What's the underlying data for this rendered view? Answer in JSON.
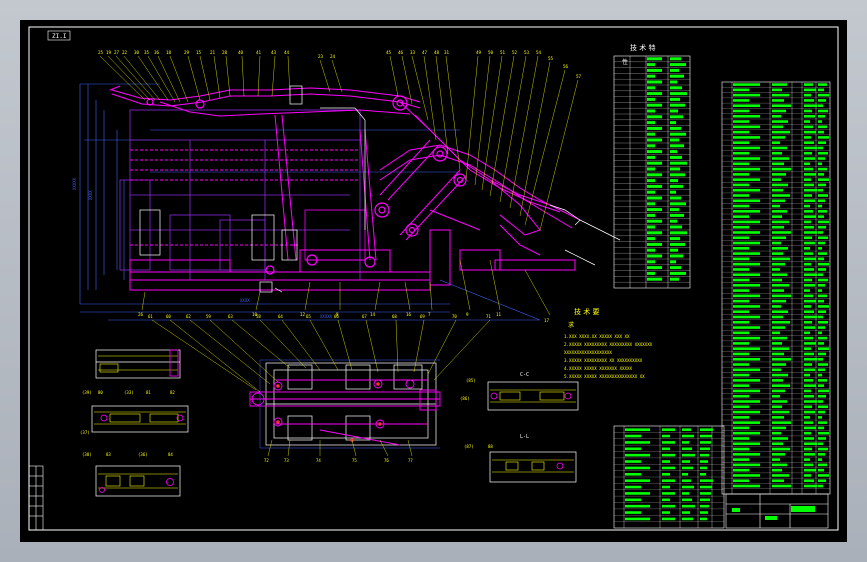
{
  "sheet": {
    "zone_label": "ZI.I",
    "tech_table_title": "技 术 特",
    "tech_table_sub": "性",
    "requirements": {
      "title": "技 术 要",
      "title2": "求",
      "lines": [
        "1.XXX XXXX.XX XXXXX XXX XX",
        "2.XXXXX XXXXXXXXX XXXXXXXXX XXXXXXX",
        "XXXXXXXXXXXXXXXXXXX",
        "3.XXXXX XXXXXXXXX XX XXXXXXXXXX",
        "4.XXXXX XXXXX XXXXXXX XXXXX",
        "5.XXXXX XXXXX XXXXXXXXXXXXXXX XX"
      ]
    },
    "section_labels": {
      "top": "C-C",
      "bottom": "L-L"
    }
  },
  "colors": {
    "background": "#000000",
    "frame": "#ffffff",
    "assembly": "#ff00ff",
    "hidden": "#8a2be2",
    "dimension": "#3f63ff",
    "outline": "#ffffff",
    "table": "#00ff00",
    "leader": "#ffff00",
    "red": "#ff3030"
  },
  "icons": [
    "bolt-circle-icon",
    "pin-circle-icon"
  ]
}
